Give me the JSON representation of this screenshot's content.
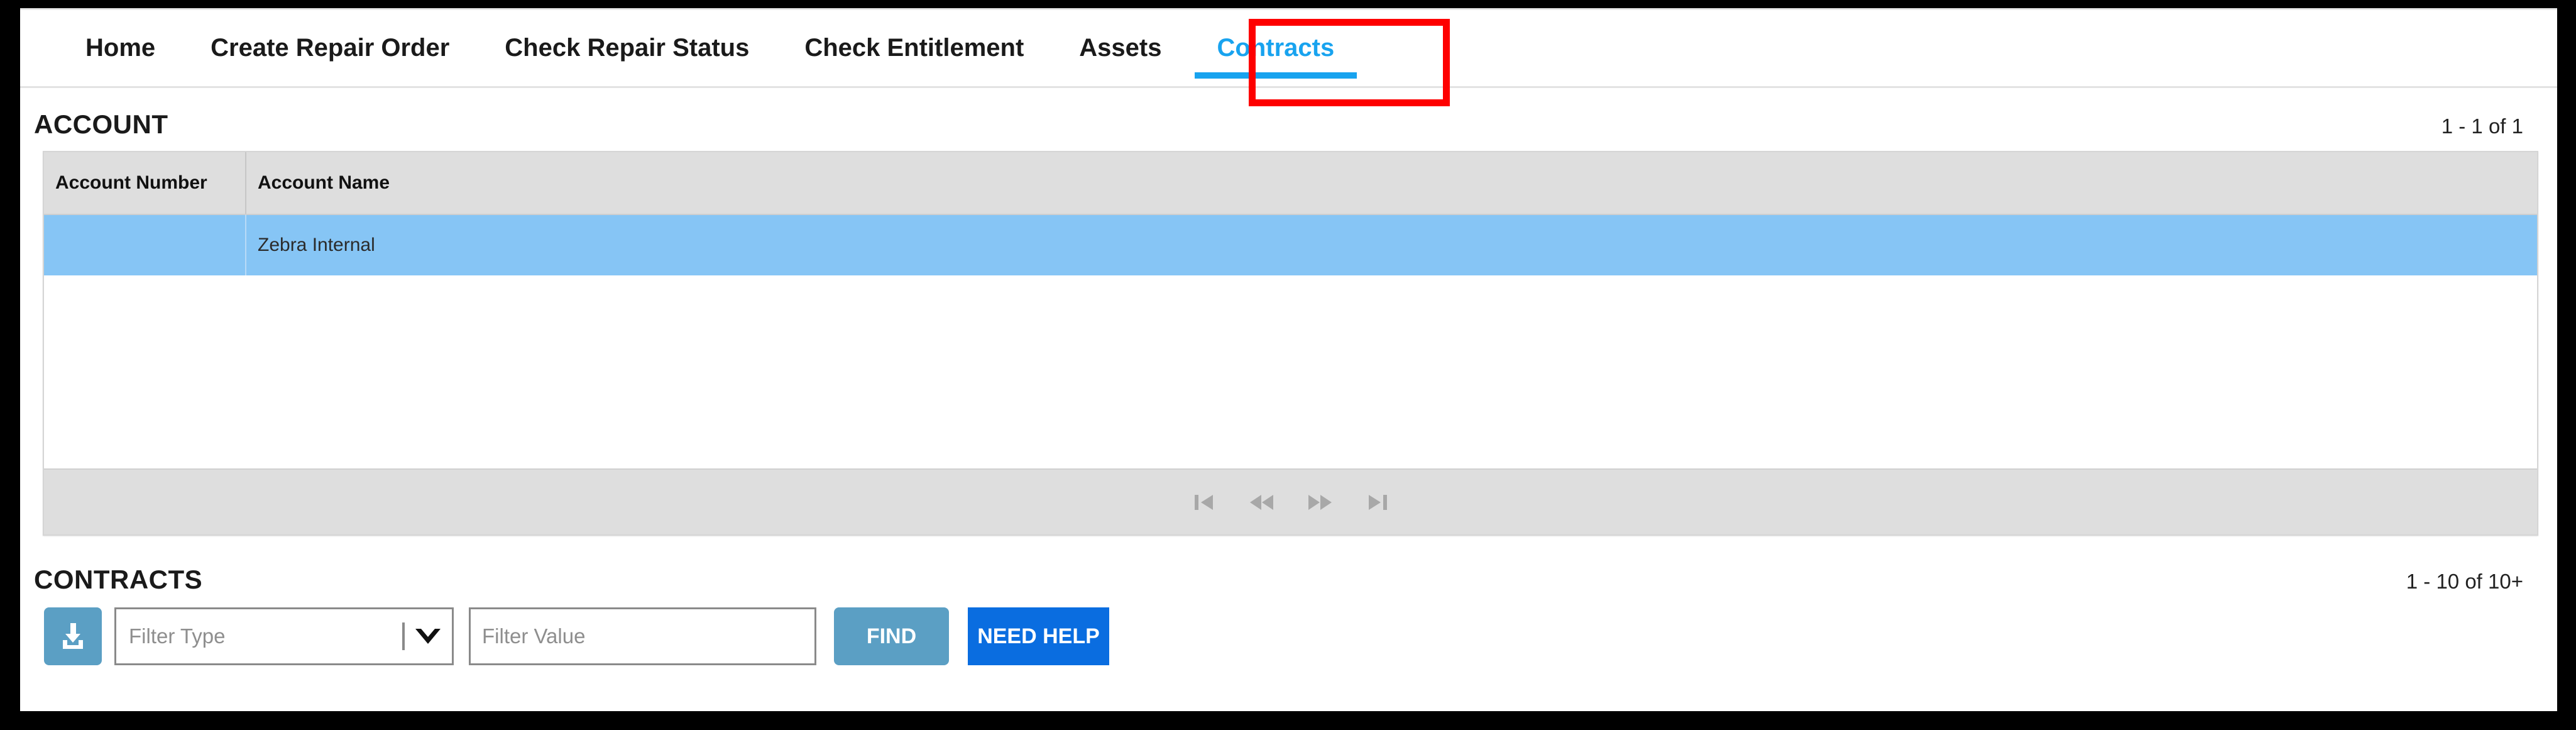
{
  "nav": {
    "tabs": [
      {
        "label": "Home",
        "active": false
      },
      {
        "label": "Create Repair Order",
        "active": false
      },
      {
        "label": "Check Repair Status",
        "active": false
      },
      {
        "label": "Check Entitlement",
        "active": false
      },
      {
        "label": "Assets",
        "active": false
      },
      {
        "label": "Contracts",
        "active": true
      }
    ],
    "active_tab": "Contracts",
    "active_color": "#18a3ef",
    "highlight_color": "#fe0000"
  },
  "account_section": {
    "title": "ACCOUNT",
    "count": "1 - 1 of 1",
    "columns": [
      "Account Number",
      "Account Name"
    ],
    "rows": [
      {
        "account_number": "",
        "account_name": "Zebra Internal",
        "selected": true
      }
    ],
    "selected_row_color": "#86c5f5",
    "header_color": "#dedede",
    "pager": [
      {
        "name": "first-page",
        "glyph": "first"
      },
      {
        "name": "previous-page",
        "glyph": "prev"
      },
      {
        "name": "next-page",
        "glyph": "next"
      },
      {
        "name": "last-page",
        "glyph": "last"
      }
    ]
  },
  "contracts_section": {
    "title": "CONTRACTS",
    "count": "1 - 10 of 10+",
    "toolbar": {
      "download_icon": "download-tray-icon",
      "download_color": "#5b9fc4",
      "filter_type_value": "Filter Type",
      "filter_type_caret": "chevron-down-icon",
      "filter_value_placeholder": "Filter Value",
      "filter_value_text": "",
      "find_label": "FIND",
      "find_color": "#5b9fc4",
      "need_help_label": "NEED HELP",
      "need_help_color": "#0a6de0"
    }
  }
}
